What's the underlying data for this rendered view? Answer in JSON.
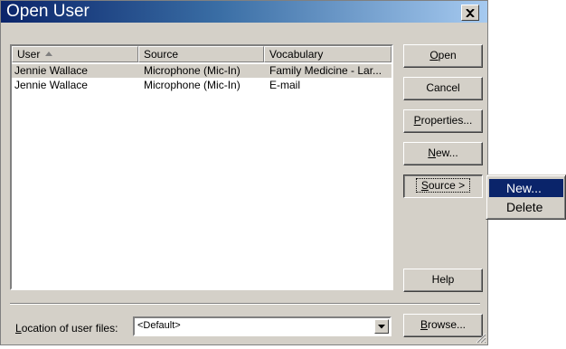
{
  "dialog": {
    "title": "Open User",
    "close_label": "close"
  },
  "list": {
    "columns": [
      "User",
      "Source",
      "Vocabulary"
    ],
    "rows": [
      {
        "user": "Jennie Wallace",
        "source": "Microphone (Mic-In)",
        "vocabulary": "Family Medicine - Lar...",
        "selected": true
      },
      {
        "user": "Jennie Wallace",
        "source": "Microphone (Mic-In)",
        "vocabulary": "E-mail",
        "selected": false
      }
    ]
  },
  "buttons": {
    "open": {
      "mnemonic": "O",
      "rest": "pen"
    },
    "cancel": {
      "label": "Cancel"
    },
    "properties": {
      "mnemonic": "P",
      "rest": "roperties..."
    },
    "new": {
      "mnemonic": "N",
      "rest": "ew..."
    },
    "source": {
      "mnemonic": "S",
      "rest": "ource >"
    },
    "help": {
      "label": "Help"
    },
    "browse": {
      "mnemonic": "B",
      "rest": "rowse..."
    }
  },
  "location": {
    "mnemonic": "L",
    "rest": "ocation of user files:",
    "value": "<Default>"
  },
  "source_menu": {
    "items": [
      "New...",
      "Delete"
    ]
  },
  "colors": {
    "titlebar_start": "#0a246a",
    "titlebar_end": "#a6caf0",
    "menu_highlight": "#0a246a",
    "face": "#d4d0c8"
  }
}
